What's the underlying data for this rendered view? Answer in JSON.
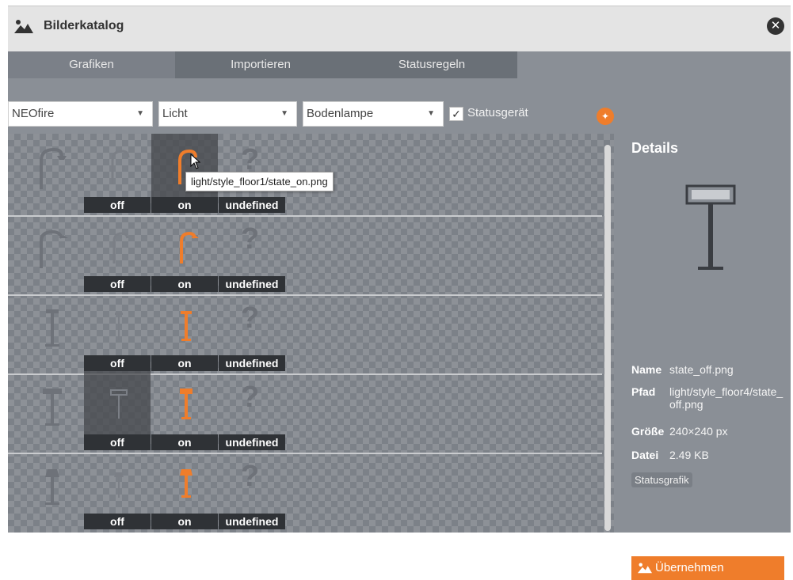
{
  "window": {
    "title": "Bilderkatalog",
    "close_icon": "close-icon"
  },
  "tabs": [
    "Grafiken",
    "Importieren",
    "Statusregeln"
  ],
  "filters": {
    "manufacturer": "NEOfire",
    "category": "Licht",
    "type": "Bodenlampe",
    "status_device_checked": true,
    "status_device_label": "Statusgerät"
  },
  "grid": {
    "state_labels": [
      "off",
      "on",
      "undefined"
    ],
    "rows": [
      {
        "style": "floor1",
        "selected_state": "on"
      },
      {
        "style": "floor2",
        "selected_state": null
      },
      {
        "style": "floor3",
        "selected_state": null
      },
      {
        "style": "floor4",
        "selected_state": "off"
      },
      {
        "style": "floor5",
        "selected_state": null
      }
    ],
    "tooltip": "light/style_floor1/state_on.png"
  },
  "details": {
    "heading": "Details",
    "name_label": "Name",
    "name_value": "state_off.png",
    "path_label": "Pfad",
    "path_value": "light/style_floor4/state_off.png",
    "size_label": "Größe",
    "size_value": "240×240 px",
    "file_label": "Datei",
    "file_value": "2.49 KB",
    "tag": "Statusgrafik",
    "apply_button": "Übernehmen"
  },
  "colors": {
    "accent": "#ef7d2b",
    "panel": "#8a8f96",
    "label_bg": "#2f3236"
  }
}
